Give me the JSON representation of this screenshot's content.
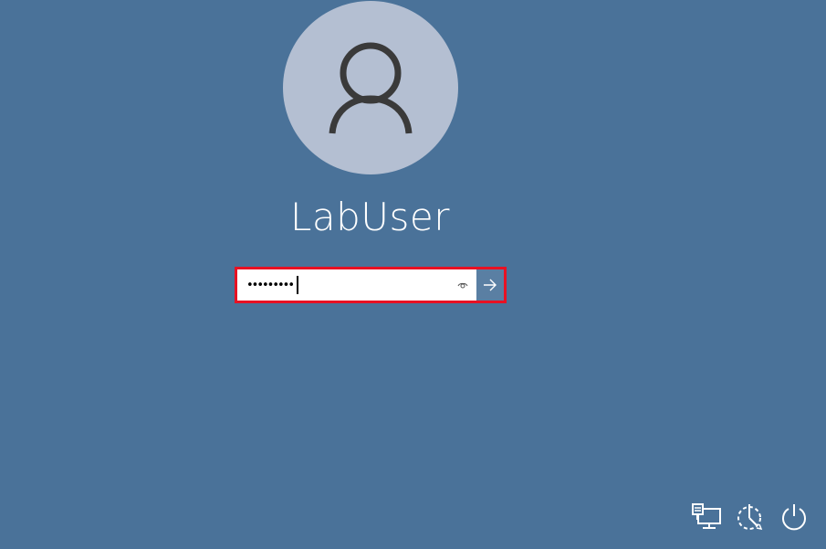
{
  "user": {
    "name": "LabUser",
    "avatar_icon": "user-silhouette-icon"
  },
  "password": {
    "masked_value": "•••••••••",
    "reveal_icon": "eye-icon",
    "submit_icon": "arrow-right-icon"
  },
  "corner_controls": [
    {
      "icon": "network-icon"
    },
    {
      "icon": "ease-of-access-icon"
    },
    {
      "icon": "power-icon"
    }
  ],
  "colors": {
    "background": "#4a7299",
    "avatar_bg": "#b4bfd2",
    "focus_border": "#e81123",
    "submit_bg": "#5a7fa3"
  }
}
